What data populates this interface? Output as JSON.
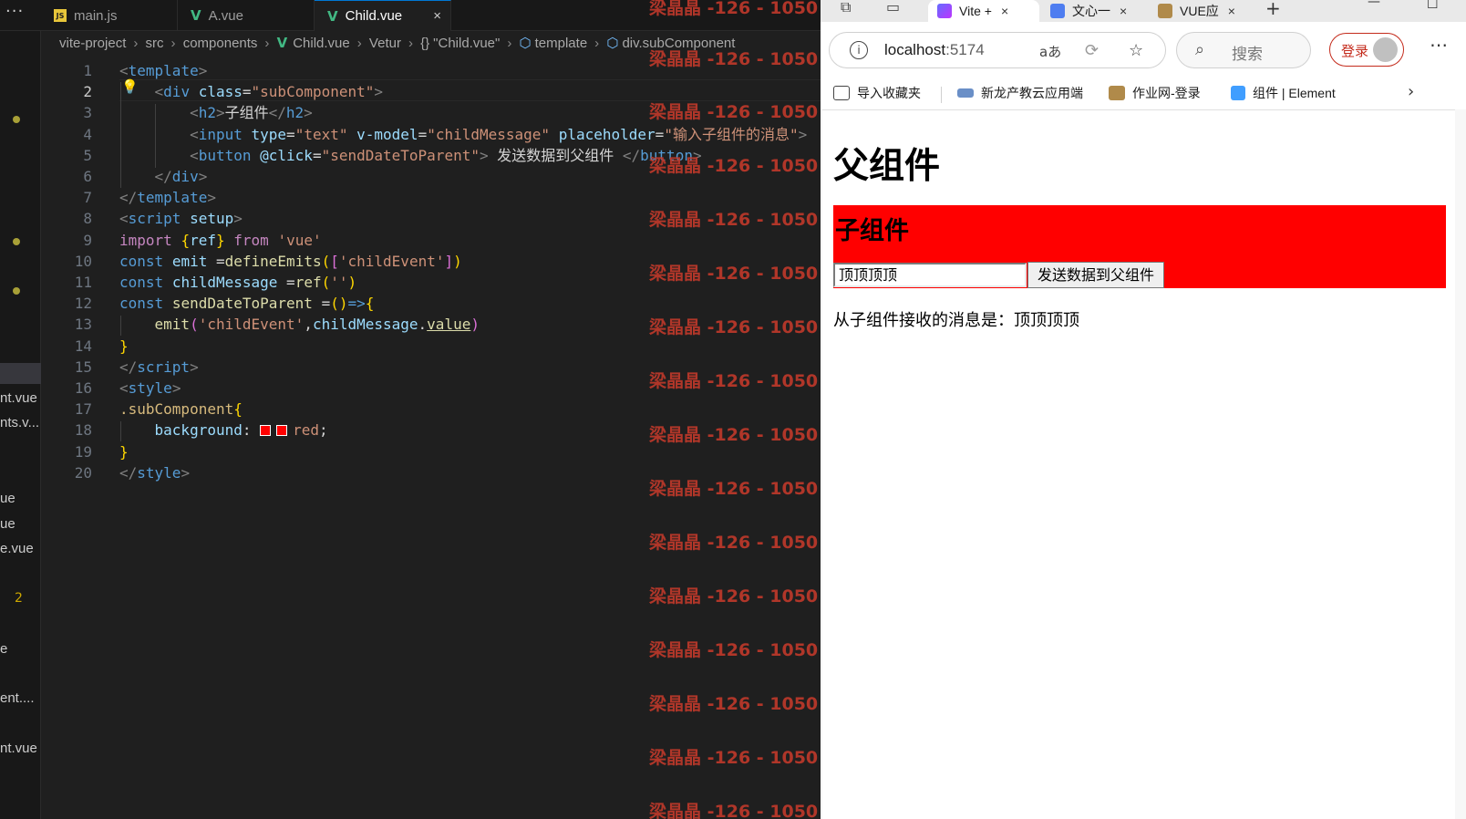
{
  "editor": {
    "menu_dots": "···",
    "tabs": [
      {
        "label": "main.js",
        "icon": "js-file-icon"
      },
      {
        "label": "A.vue",
        "icon": "vue-file-icon"
      },
      {
        "label": "Child.vue",
        "icon": "vue-file-icon",
        "active": true
      }
    ],
    "tab_close": "×",
    "breadcrumb": [
      "vite-project",
      "src",
      "components",
      "Child.vue",
      "Vetur",
      "\"Child.vue\"",
      "template",
      "div.subComponent"
    ],
    "breadcrumb_symbol": "{}",
    "sidebar_labels": [
      "nt.vue",
      "nts.v...",
      "ue",
      "ue",
      "e.vue",
      "e",
      "ent....",
      "nt.vue"
    ],
    "sidebar_badge": "2",
    "line_numbers": [
      "1",
      "2",
      "3",
      "4",
      "5",
      "6",
      "7",
      "8",
      "9",
      "10",
      "11",
      "12",
      "13",
      "14",
      "15",
      "16",
      "17",
      "18",
      "19",
      "20"
    ],
    "code": {
      "l1": "template",
      "l2_tag": "div",
      "l2_attr": "class",
      "l2_val": "\"subComponent\"",
      "l3_tag": "h2",
      "l3_text": "子组件",
      "l4_tag": "input",
      "l4_a1": "type",
      "l4_v1": "\"text\"",
      "l4_a2": "v-model",
      "l4_v2": "\"childMessage\"",
      "l4_a3": "placeholder",
      "l4_v3": "\"输入子组件的消息\"",
      "l5_tag": "button",
      "l5_attr": "@click",
      "l5_val": "\"sendDateToParent\"",
      "l5_text": " 发送数据到父组件 ",
      "l6_tag": "div",
      "l7_tag": "template",
      "l8_tag": "script",
      "l8_attr": "setup",
      "l9_kw": "import",
      "l9_var": "ref",
      "l9_from": "from",
      "l9_str": "'vue'",
      "l10_kw": "const",
      "l10_var": "emit",
      "l10_fn": "defineEmits",
      "l10_str": "'childEvent'",
      "l11_kw": "const",
      "l11_var": "childMessage",
      "l11_fn": "ref",
      "l11_str": "''",
      "l12_kw": "const",
      "l12_fn": "sendDateToParent",
      "l13_fn": "emit",
      "l13_str": "'childEvent'",
      "l13_var": "childMessage",
      "l13_prop": "value",
      "l15_tag": "script",
      "l16_tag": "style",
      "l17_cls": ".subComponent",
      "l18_prop": "background",
      "l18_val": "red",
      "l20_tag": "style"
    },
    "watermark": "梁晶晶 -126 - 1050"
  },
  "browser": {
    "tabs": [
      {
        "label": "Vite +",
        "active": true
      },
      {
        "label": "文心一"
      },
      {
        "label": "VUE应"
      }
    ],
    "tab_close": "×",
    "new_tab": "+",
    "window_min": "—",
    "window_max": "☐",
    "url_host": "localhost",
    "url_port": ":5174",
    "read_aloud": "aあ",
    "search_placeholder": "搜索",
    "login_label": "登录",
    "favorites": [
      "导入收藏夹",
      "新龙产教云应用端",
      "作业网-登录",
      "组件 | Element"
    ],
    "favorites_more": "›"
  },
  "page": {
    "parent_title": "父组件",
    "child_title": "子组件",
    "input_value": "顶顶顶顶",
    "send_button": "发送数据到父组件",
    "received_label": "从子组件接收的消息是：",
    "received_value": "顶顶顶顶"
  },
  "colors": {
    "child_background": "#ff0000",
    "editor_bg": "#1f1f1f",
    "watermark": "#c0392b",
    "vue_icon": "#42b883"
  }
}
